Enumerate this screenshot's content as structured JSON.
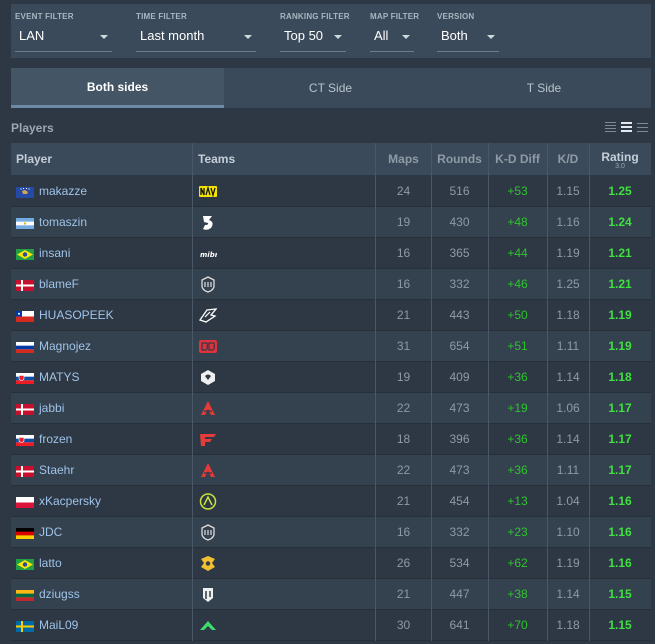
{
  "filters": [
    {
      "label": "EVENT FILTER",
      "value": "LAN"
    },
    {
      "label": "TIME FILTER",
      "value": "Last month"
    },
    {
      "label": "RANKING FILTER",
      "value": "Top 50"
    },
    {
      "label": "MAP FILTER",
      "value": "All"
    },
    {
      "label": "VERSION",
      "value": "Both"
    }
  ],
  "tabs": [
    {
      "label": "Both sides",
      "active": true
    },
    {
      "label": "CT Side",
      "active": false
    },
    {
      "label": "T Side",
      "active": false
    }
  ],
  "section_title": "Players",
  "table": {
    "headers": {
      "player": "Player",
      "teams": "Teams",
      "maps": "Maps",
      "rounds": "Rounds",
      "kddiff": "K-D Diff",
      "kd": "K/D",
      "rating": "Rating",
      "rating_version": "3.0"
    },
    "rows": [
      {
        "player": "makazze",
        "flag": "kosovo",
        "team_icon": "navi-logo-icon",
        "maps": "24",
        "rounds": "516",
        "kd_diff": "+53",
        "kd": "1.15",
        "rating": "1.25"
      },
      {
        "player": "tomaszin",
        "flag": "argentina",
        "team_icon": "bestia-logo-icon",
        "maps": "19",
        "rounds": "430",
        "kd_diff": "+48",
        "kd": "1.16",
        "rating": "1.24"
      },
      {
        "player": "insani",
        "flag": "brazil",
        "team_icon": "mibr-logo-icon",
        "maps": "16",
        "rounds": "365",
        "kd_diff": "+44",
        "kd": "1.19",
        "rating": "1.21"
      },
      {
        "player": "blameF",
        "flag": "denmark",
        "team_icon": "big-logo-icon",
        "maps": "16",
        "rounds": "332",
        "kd_diff": "+46",
        "kd": "1.25",
        "rating": "1.21"
      },
      {
        "player": "HUASOPEEK",
        "flag": "chile",
        "team_icon": "wings-logo-icon",
        "maps": "21",
        "rounds": "443",
        "kd_diff": "+50",
        "kd": "1.18",
        "rating": "1.19"
      },
      {
        "player": "Magnojez",
        "flag": "russia",
        "team_icon": "betboom-logo-icon",
        "maps": "31",
        "rounds": "654",
        "kd_diff": "+51",
        "kd": "1.11",
        "rating": "1.19"
      },
      {
        "player": "MATYS",
        "flag": "slovakia",
        "team_icon": "g2-logo-icon",
        "maps": "19",
        "rounds": "409",
        "kd_diff": "+36",
        "kd": "1.14",
        "rating": "1.18"
      },
      {
        "player": "jabbi",
        "flag": "denmark",
        "team_icon": "astralis-logo-icon",
        "maps": "22",
        "rounds": "473",
        "kd_diff": "+19",
        "kd": "1.06",
        "rating": "1.17"
      },
      {
        "player": "frozen",
        "flag": "slovakia",
        "team_icon": "faze-logo-icon",
        "maps": "18",
        "rounds": "396",
        "kd_diff": "+36",
        "kd": "1.14",
        "rating": "1.17"
      },
      {
        "player": "Staehr",
        "flag": "denmark",
        "team_icon": "astralis-logo-icon",
        "maps": "22",
        "rounds": "473",
        "kd_diff": "+36",
        "kd": "1.11",
        "rating": "1.17"
      },
      {
        "player": "xKacpersky",
        "flag": "poland",
        "team_icon": "nip-logo-icon",
        "maps": "21",
        "rounds": "454",
        "kd_diff": "+13",
        "kd": "1.04",
        "rating": "1.16"
      },
      {
        "player": "JDC",
        "flag": "germany",
        "team_icon": "big-logo-icon",
        "maps": "16",
        "rounds": "332",
        "kd_diff": "+23",
        "kd": "1.10",
        "rating": "1.16"
      },
      {
        "player": "latto",
        "flag": "brazil",
        "team_icon": "legacy-logo-icon",
        "maps": "26",
        "rounds": "534",
        "kd_diff": "+62",
        "kd": "1.19",
        "rating": "1.16"
      },
      {
        "player": "dziugss",
        "flag": "lithuania",
        "team_icon": "pain-logo-icon",
        "maps": "21",
        "rounds": "447",
        "kd_diff": "+38",
        "kd": "1.14",
        "rating": "1.15"
      },
      {
        "player": "MaiL09",
        "flag": "sweden",
        "team_icon": "mouz-logo-icon",
        "maps": "30",
        "rounds": "641",
        "kd_diff": "+70",
        "kd": "1.18",
        "rating": "1.15"
      }
    ]
  },
  "colors": {
    "background": "#2d3844",
    "panel": "#3b4a5a",
    "player_link": "#9fc3e8",
    "positive": "#2ec42e",
    "rating": "#3fe03f"
  }
}
